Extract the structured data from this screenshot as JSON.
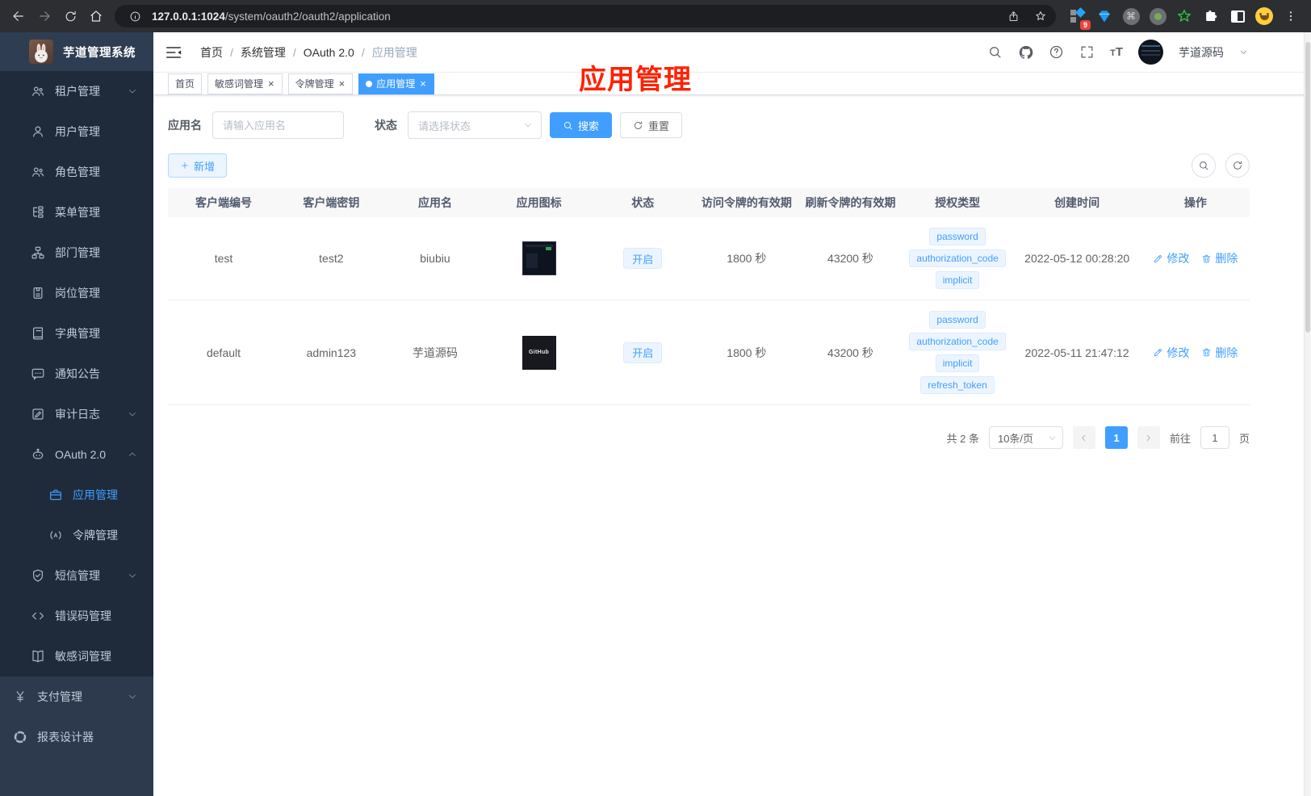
{
  "browser": {
    "url_host": "127.0.0.1:1024",
    "url_path": "/system/oauth2/oauth2/application",
    "extension_badge": "9"
  },
  "sidebar": {
    "logo_text": "芋道管理系统",
    "sub_items": [
      {
        "icon": "users-icon",
        "label": "租户管理",
        "chevron": "down"
      },
      {
        "icon": "user-icon",
        "label": "用户管理"
      },
      {
        "icon": "role-users-icon",
        "label": "角色管理"
      },
      {
        "icon": "menu-tree-icon",
        "label": "菜单管理"
      },
      {
        "icon": "sitemap-icon",
        "label": "部门管理"
      },
      {
        "icon": "post-badge-icon",
        "label": "岗位管理"
      },
      {
        "icon": "dict-book-icon",
        "label": "字典管理"
      },
      {
        "icon": "message-icon",
        "label": "通知公告"
      },
      {
        "icon": "journal-edit-icon",
        "label": "审计日志",
        "chevron": "down"
      },
      {
        "icon": "robot-icon",
        "label": "OAuth 2.0",
        "chevron": "up"
      },
      {
        "icon": "briefcase-icon",
        "label": "应用管理",
        "child": true,
        "active": true
      },
      {
        "icon": "token-icon",
        "label": "令牌管理",
        "child": true
      },
      {
        "icon": "shield-check-icon",
        "label": "短信管理",
        "chevron": "down"
      },
      {
        "icon": "code-icon",
        "label": "错误码管理"
      },
      {
        "icon": "open-book-icon",
        "label": "敏感词管理"
      }
    ],
    "root_items": [
      {
        "icon": "yen-icon",
        "label": "支付管理",
        "chevron": "down"
      },
      {
        "icon": "report-icon",
        "label": "报表设计器"
      }
    ]
  },
  "navbar": {
    "breadcrumb": [
      "首页",
      "系统管理",
      "OAuth 2.0",
      "应用管理"
    ],
    "username": "芋道源码"
  },
  "tabs": [
    {
      "label": "首页",
      "active": false,
      "closable": false
    },
    {
      "label": "敏感词管理",
      "active": false,
      "closable": true
    },
    {
      "label": "令牌管理",
      "active": false,
      "closable": true
    },
    {
      "label": "应用管理",
      "active": true,
      "closable": true
    }
  ],
  "annotation": {
    "text": "应用管理",
    "color": "#ff2000"
  },
  "filters": {
    "name_label": "应用名",
    "name_placeholder": "请输入应用名",
    "status_label": "状态",
    "status_placeholder": "请选择状态",
    "search_label": "搜索",
    "reset_label": "重置"
  },
  "toolbar": {
    "add_label": "新增"
  },
  "table": {
    "columns": [
      "客户端编号",
      "客户端密钥",
      "应用名",
      "应用图标",
      "状态",
      "访问令牌的有效期",
      "刷新令牌的有效期",
      "授权类型",
      "创建时间",
      "操作"
    ],
    "rows": [
      {
        "client_id": "test",
        "client_secret": "test2",
        "app_name": "biubiu",
        "app_icon": "screenshot-thumbnail",
        "status": "开启",
        "access_token_validity": "1800 秒",
        "refresh_token_validity": "43200 秒",
        "grant_types": [
          "password",
          "authorization_code",
          "implicit"
        ],
        "created_at": "2022-05-12 00:28:20"
      },
      {
        "client_id": "default",
        "client_secret": "admin123",
        "app_name": "芋道源码",
        "app_icon": "github-logo",
        "app_icon_text": "GitHub",
        "status": "开启",
        "access_token_validity": "1800 秒",
        "refresh_token_validity": "43200 秒",
        "grant_types": [
          "password",
          "authorization_code",
          "implicit",
          "refresh_token"
        ],
        "created_at": "2022-05-11 21:47:12"
      }
    ],
    "actions": {
      "edit": "修改",
      "delete": "删除"
    }
  },
  "pagination": {
    "total_text": "共 2 条",
    "page_size": "10条/页",
    "current_page": "1",
    "goto_label": "前往",
    "goto_value": "1",
    "page_unit": "页"
  },
  "colors": {
    "accent": "#409eff",
    "annotation_red": "#ff2000",
    "sidebar_bg": "#2d3a4e",
    "submenu_bg": "#1f2b3a",
    "tag_bg": "#ecf5ff"
  }
}
